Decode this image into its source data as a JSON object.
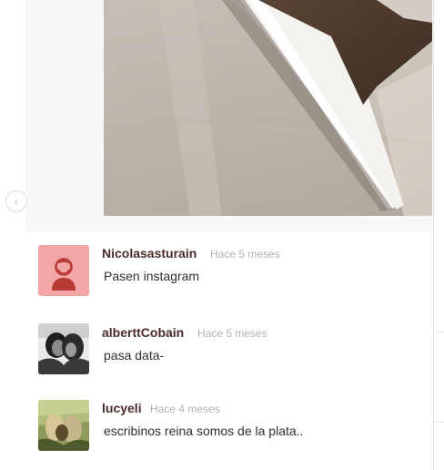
{
  "photo": {
    "icon": "post-photo"
  },
  "nav": {
    "prev_icon": "chevron-left-icon",
    "prev_glyph": "‹"
  },
  "comments": [
    {
      "username": "Nicolasasturain",
      "time": "Hace 5 meses",
      "text": "Pasen instagram",
      "avatar": "default-avatar",
      "avatar_bg": "#f3a6a6"
    },
    {
      "username": "alberttCobain",
      "time": "Hace 5 meses",
      "text": "pasa data-",
      "avatar": "photo-avatar"
    },
    {
      "username": "lucyeli",
      "time": "Hace 4 meses",
      "text": "escribinos reina somos de la plata..",
      "avatar": "photo-avatar"
    }
  ]
}
